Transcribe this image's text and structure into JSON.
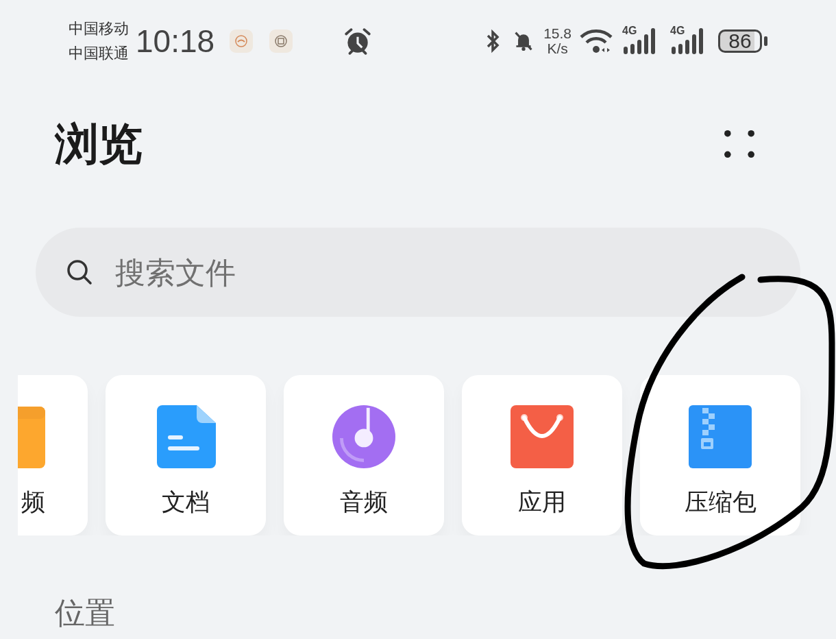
{
  "status_bar": {
    "carriers": [
      "中国移动",
      "中国联通"
    ],
    "time": "10:18",
    "speed": {
      "value": "15.8",
      "unit": "K/s"
    },
    "signals": [
      {
        "label": "4G"
      },
      {
        "label": "4G"
      }
    ],
    "battery": "86"
  },
  "header": {
    "title": "浏览"
  },
  "search": {
    "placeholder": "搜索文件"
  },
  "categories": [
    {
      "kind": "video",
      "label": "频"
    },
    {
      "kind": "document",
      "label": "文档"
    },
    {
      "kind": "audio",
      "label": "音频"
    },
    {
      "kind": "app",
      "label": "应用"
    },
    {
      "kind": "archive",
      "label": "压缩包"
    }
  ],
  "section_title": "位置"
}
